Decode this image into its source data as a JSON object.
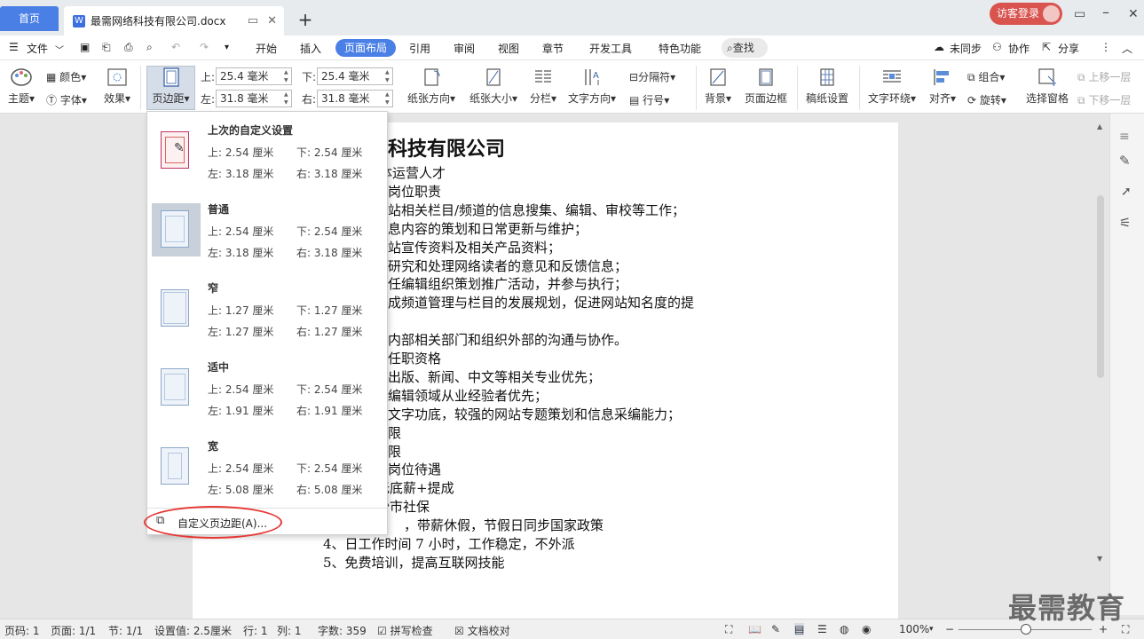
{
  "titlebar": {
    "home_tab": "首页",
    "doc_tab": "最需网络科技有限公司.docx",
    "login": "访客登录"
  },
  "menu": {
    "file": "文件",
    "items": [
      "开始",
      "插入",
      "页面布局",
      "引用",
      "审阅",
      "视图",
      "章节",
      "开发工具",
      "特色功能"
    ],
    "search": "查找",
    "sync": "未同步",
    "collab": "协作",
    "share": "分享"
  },
  "ribbon": {
    "theme": "主题",
    "color": "颜色",
    "font": "字体",
    "effect": "效果",
    "margins": "页边距",
    "top_lbl": "上:",
    "bottom_lbl": "下:",
    "left_lbl": "左:",
    "right_lbl": "右:",
    "top_val": "25.4 毫米",
    "bottom_val": "25.4 毫米",
    "left_val": "31.8 毫米",
    "right_val": "31.8 毫米",
    "orientation": "纸张方向",
    "size": "纸张大小",
    "columns": "分栏",
    "text_dir": "文字方向",
    "breaks": "分隔符",
    "line_num": "行号",
    "background": "背景",
    "page_border": "页面边框",
    "grid_paper": "稿纸设置",
    "wrap": "文字环绕",
    "align": "对齐",
    "group": "组合",
    "rotate": "旋转",
    "select_pane": "选择窗格",
    "bring_fwd": "上移一层",
    "send_back": "下移一层"
  },
  "dropdown": {
    "options": [
      {
        "name": "上次的自定义设置",
        "top": "上: 2.54 厘米",
        "bottom": "下: 2.54 厘米",
        "left": "左: 3.18 厘米",
        "right": "右: 3.18 厘米"
      },
      {
        "name": "普通",
        "top": "上: 2.54 厘米",
        "bottom": "下: 2.54 厘米",
        "left": "左: 3.18 厘米",
        "right": "右: 3.18 厘米"
      },
      {
        "name": "窄",
        "top": "上: 1.27 厘米",
        "bottom": "下: 1.27 厘米",
        "left": "左: 1.27 厘米",
        "right": "右: 1.27 厘米"
      },
      {
        "name": "适中",
        "top": "上: 2.54 厘米",
        "bottom": "下: 2.54 厘米",
        "left": "左: 1.91 厘米",
        "right": "右: 1.91 厘米"
      },
      {
        "name": "宽",
        "top": "上: 2.54 厘米",
        "bottom": "下: 2.54 厘米",
        "left": "左: 5.08 厘米",
        "right": "右: 5.08 厘米"
      }
    ],
    "custom": "自定义页边距(A)..."
  },
  "document": {
    "title": "科技有限公司",
    "lines": [
      "体运营人才",
      "  岗位职责",
      "站相关栏目/频道的信息搜集、编辑、审校等工作；",
      "息内容的策划和日常更新与维护；",
      "站宣传资料及相关产品资料；",
      "研究和处理网络读者的意见和反馈信息；",
      "任编辑组织策划推广活动，并参与执行；",
      "成频道管理与栏目的发展规划，促进网站知名度的提",
      "",
      "内部相关部门和组织外部的沟通与协作。",
      "  任职资格",
      "出版、新闻、中文等相关专业优先；",
      "编辑领域从业经验者优先；",
      "文字功底，较强的网站专题策划和信息采编能力；",
      "限",
      "限",
      "  岗位待遇",
      "无底薪+提成",
      "沙市社保",
      "，带薪休假，节假日同步国家政策",
      "4、日工作时间 7 小时，工作稳定，不外派",
      "5、免费培训，提高互联网技能"
    ]
  },
  "status": {
    "page_code": "页码: 1",
    "pages": "页面: 1/1",
    "section": "节: 1/1",
    "setting": "设置值: 2.5厘米",
    "row": "行: 1",
    "col": "列: 1",
    "words": "字数: 359",
    "spell": "拼写检查",
    "proof": "文档校对",
    "zoom": "100%"
  },
  "watermark": "最需教育"
}
